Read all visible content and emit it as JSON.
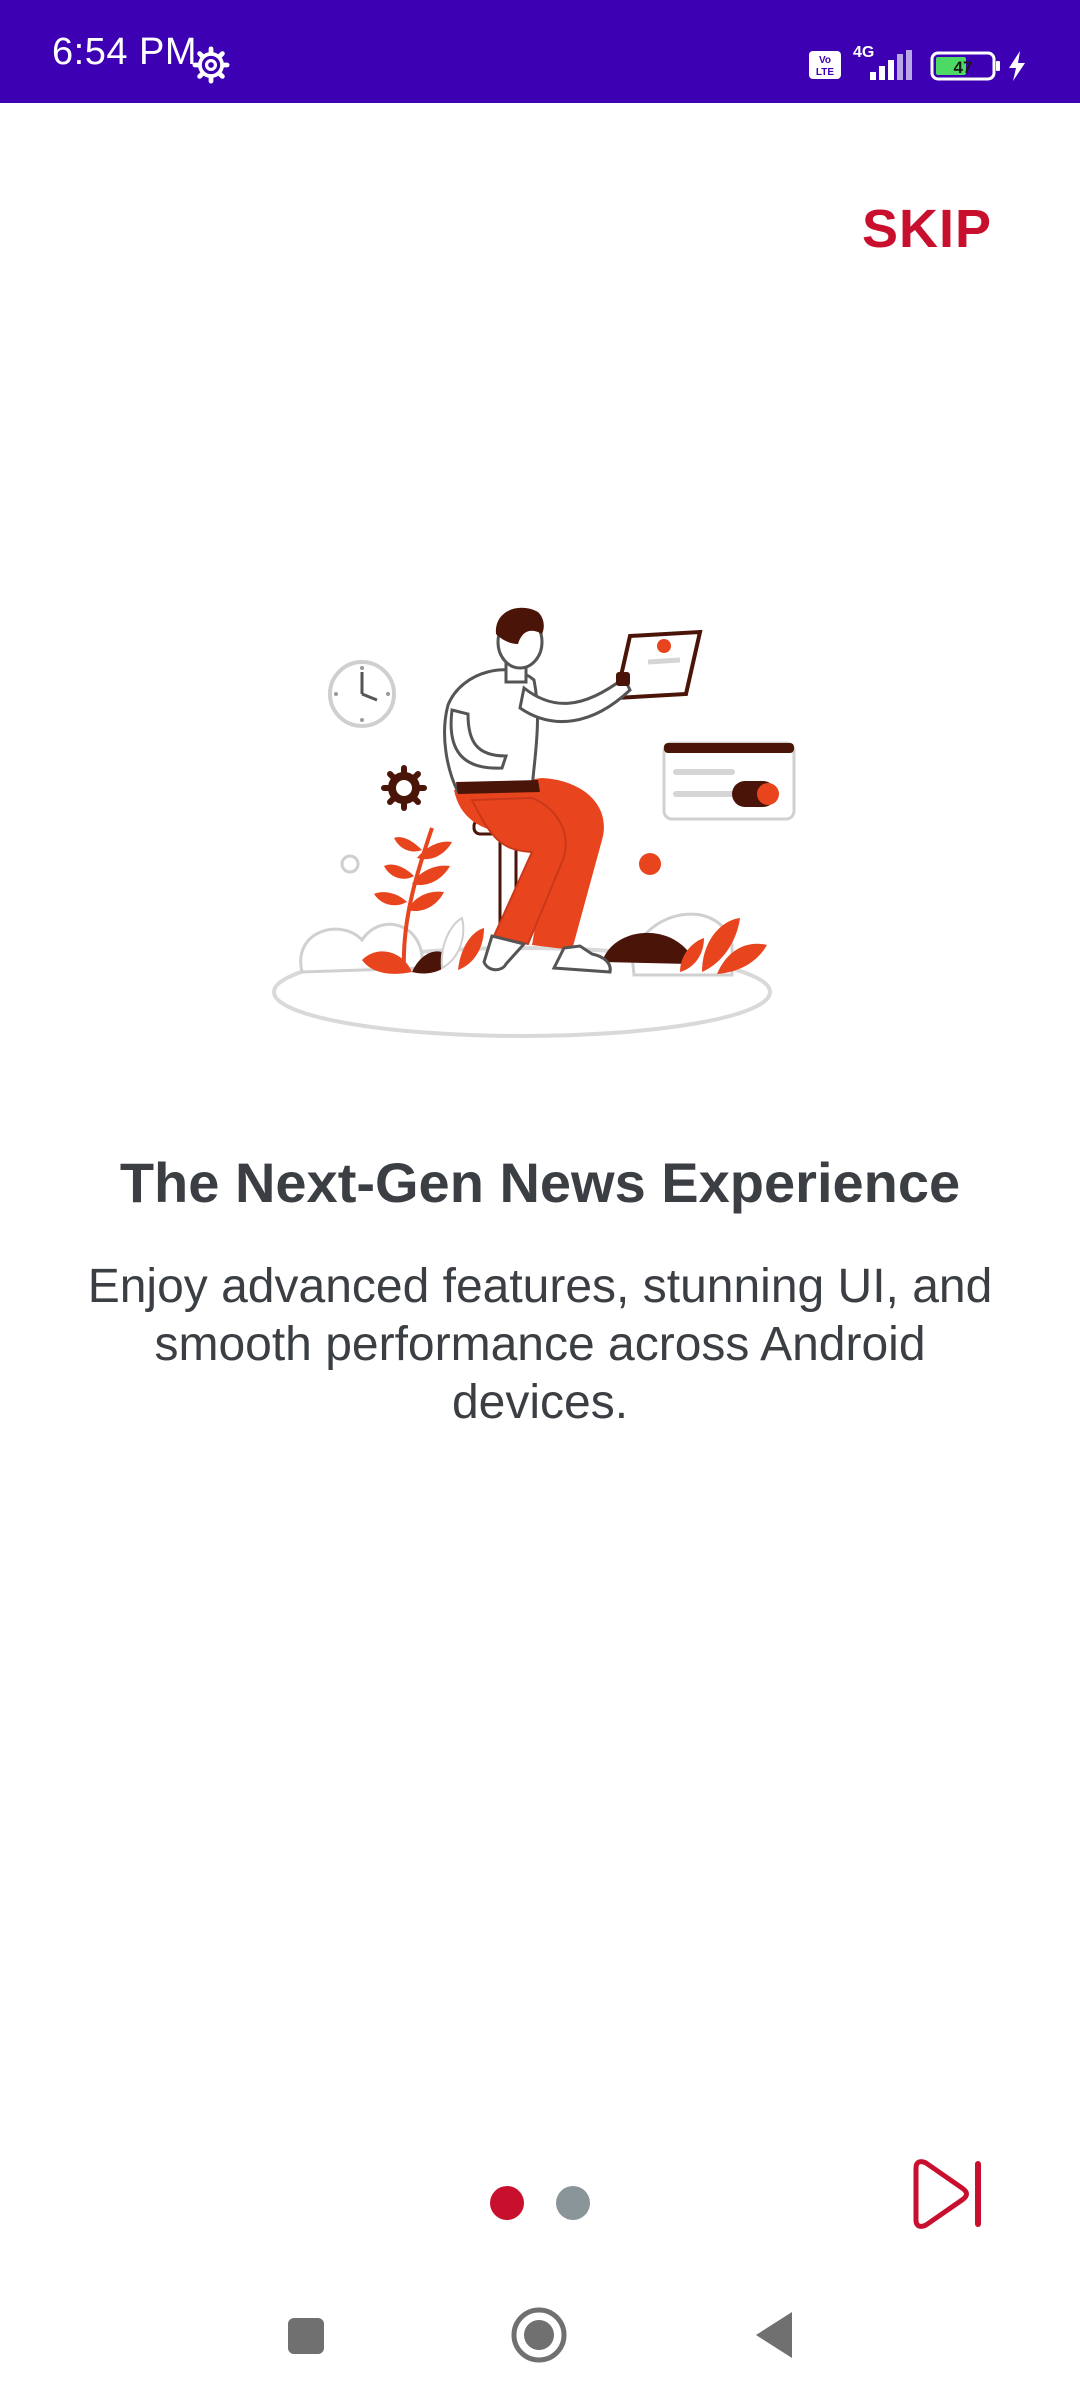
{
  "status_bar": {
    "time": "6:54 PM",
    "network": "4G",
    "volte": "Vo LTE",
    "battery": "47",
    "icons": [
      "settings-gear-icon",
      "volte-icon",
      "signal-icon",
      "battery-icon",
      "charging-bolt-icon"
    ]
  },
  "onboarding": {
    "skip_label": "SKIP",
    "headline": "The Next-Gen News Experience",
    "body": "Enjoy advanced features, stunning UI, and smooth performance across Android devices.",
    "page_indicator": {
      "current": 1,
      "total": 2
    },
    "next_icon": "skip-next-icon"
  },
  "colors": {
    "status_bar": "#3d00b3",
    "accent": "#c8102e",
    "text": "#3b3f44",
    "dot_inactive": "#8a9599"
  },
  "nav_bar": {
    "icons": [
      "recent-apps-icon",
      "home-icon",
      "back-icon"
    ]
  }
}
